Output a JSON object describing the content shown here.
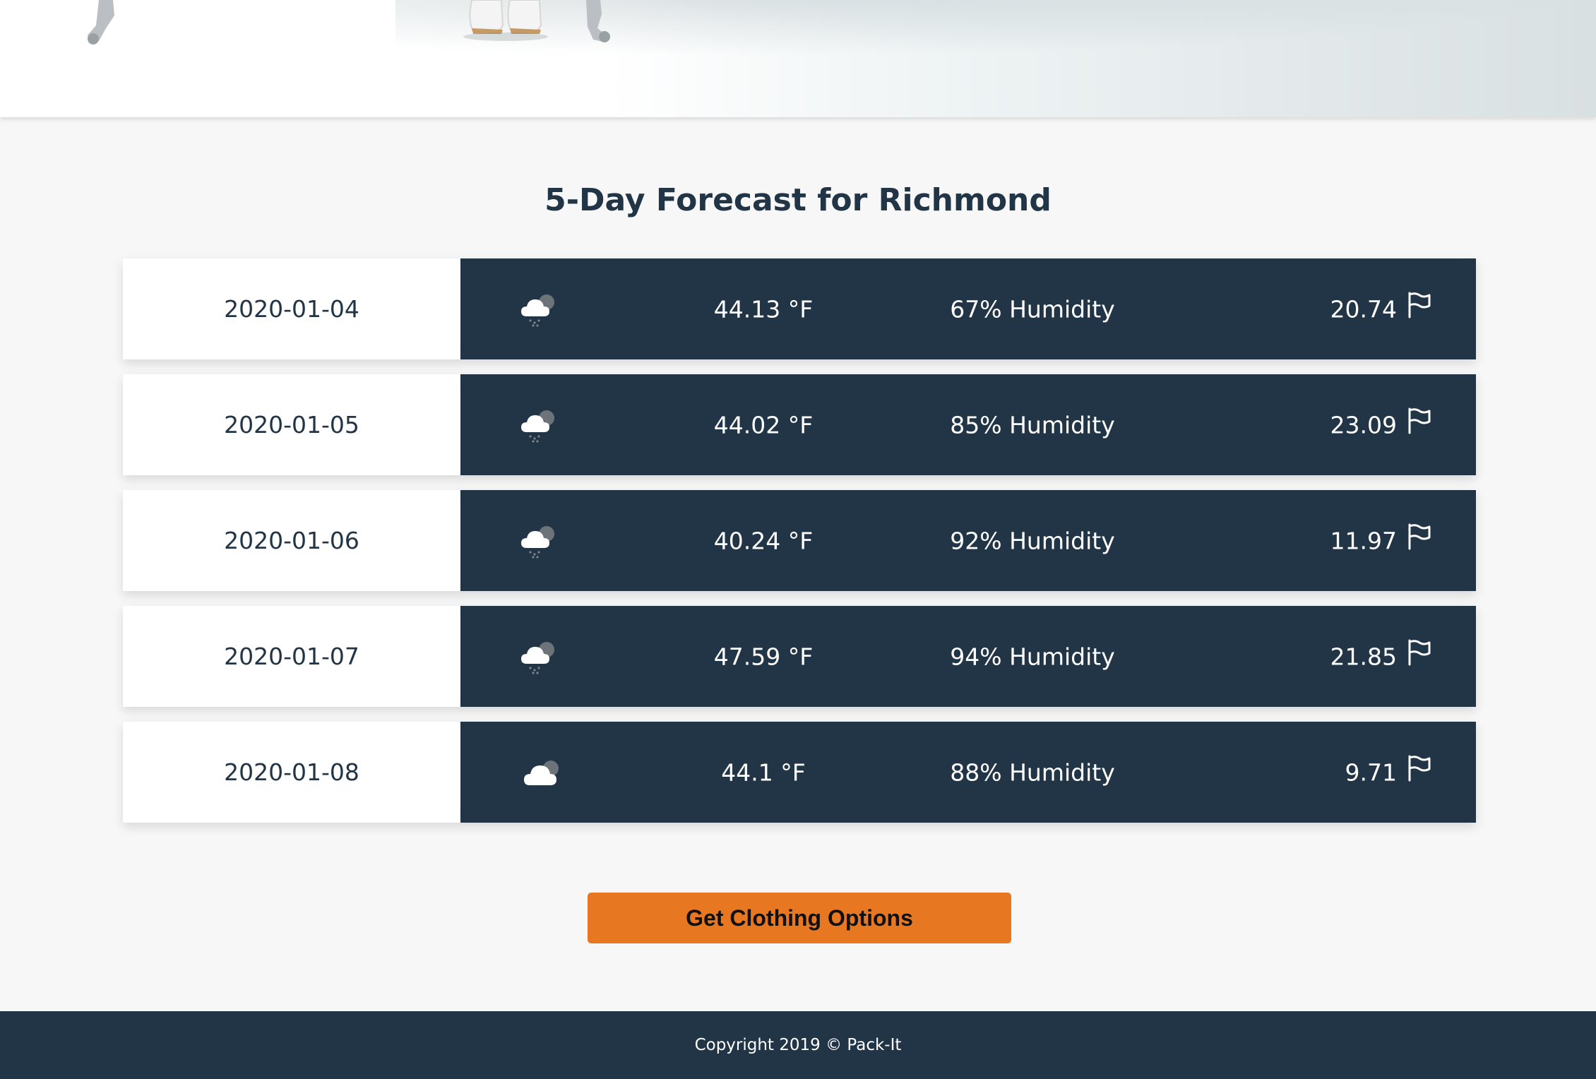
{
  "page": {
    "title": "5-Day Forecast for Richmond",
    "colors": {
      "navy": "#213547",
      "accent": "#e87722",
      "background": "#f7f7f7"
    }
  },
  "forecast": [
    {
      "date": "2020-01-04",
      "icon": "cloud-rain-icon",
      "temp": "44.13 °F",
      "humidity": "67% Humidity",
      "wind": "20.74"
    },
    {
      "date": "2020-01-05",
      "icon": "cloud-rain-icon",
      "temp": "44.02 °F",
      "humidity": "85% Humidity",
      "wind": "23.09"
    },
    {
      "date": "2020-01-06",
      "icon": "cloud-rain-icon",
      "temp": "40.24 °F",
      "humidity": "92% Humidity",
      "wind": "11.97"
    },
    {
      "date": "2020-01-07",
      "icon": "cloud-rain-icon",
      "temp": "47.59 °F",
      "humidity": "94% Humidity",
      "wind": "21.85"
    },
    {
      "date": "2020-01-08",
      "icon": "cloudy-icon",
      "temp": "44.1 °F",
      "humidity": "88% Humidity",
      "wind": "9.71"
    }
  ],
  "actions": {
    "clothing_button": "Get Clothing Options"
  },
  "footer": {
    "copyright": "Copyright 2019 © Pack-It"
  }
}
